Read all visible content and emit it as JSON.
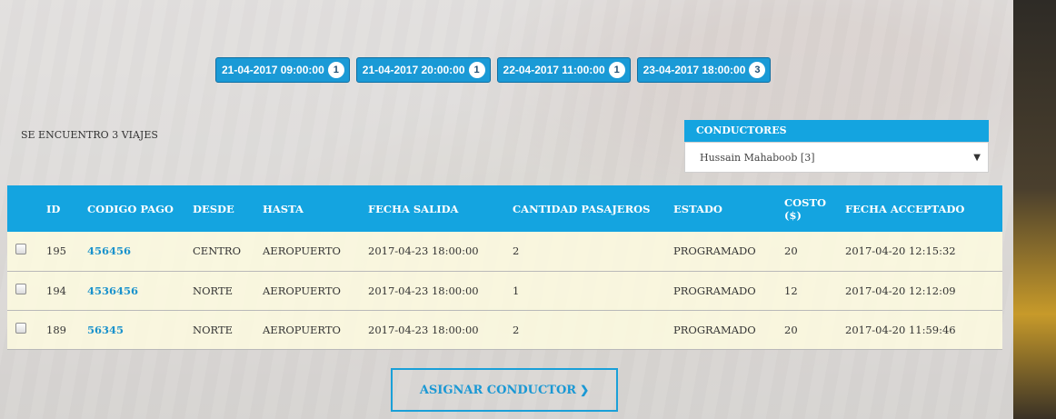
{
  "date_filters": [
    {
      "label": "21-04-2017 09:00:00",
      "count": "1"
    },
    {
      "label": "21-04-2017 20:00:00",
      "count": "1"
    },
    {
      "label": "22-04-2017 11:00:00",
      "count": "1"
    },
    {
      "label": "23-04-2017 18:00:00",
      "count": "3"
    }
  ],
  "summary": "SE ENCUENTRO 3 VIAJES",
  "conductores": {
    "title": "CONDUCTORES",
    "selected": "Hussain Mahaboob [3]"
  },
  "table": {
    "headers": [
      "ID",
      "CODIGO PAGO",
      "DESDE",
      "HASTA",
      "FECHA SALIDA",
      "CANTIDAD PASAJEROS",
      "ESTADO",
      "COSTO",
      "($)",
      "FECHA ACCEPTADO"
    ],
    "rows": [
      {
        "id": "195",
        "codigo": "456456",
        "desde": "CENTRO",
        "hasta": "AEROPUERTO",
        "salida": "2017-04-23 18:00:00",
        "pasajeros": "2",
        "estado": "PROGRAMADO",
        "costo": "20",
        "aceptado": "2017-04-20 12:15:32"
      },
      {
        "id": "194",
        "codigo": "4536456",
        "desde": "NORTE",
        "hasta": "AEROPUERTO",
        "salida": "2017-04-23 18:00:00",
        "pasajeros": "1",
        "estado": "PROGRAMADO",
        "costo": "12",
        "aceptado": "2017-04-20 12:12:09"
      },
      {
        "id": "189",
        "codigo": "56345",
        "desde": "NORTE",
        "hasta": "AEROPUERTO",
        "salida": "2017-04-23 18:00:00",
        "pasajeros": "2",
        "estado": "PROGRAMADO",
        "costo": "20",
        "aceptado": "2017-04-20 11:59:46"
      }
    ]
  },
  "assign_button": {
    "label": "ASIGNAR CONDUCTOR",
    "icon": "chevron-right-icon"
  },
  "colors": {
    "accent": "#14a4e0",
    "link": "#1a92cc"
  }
}
